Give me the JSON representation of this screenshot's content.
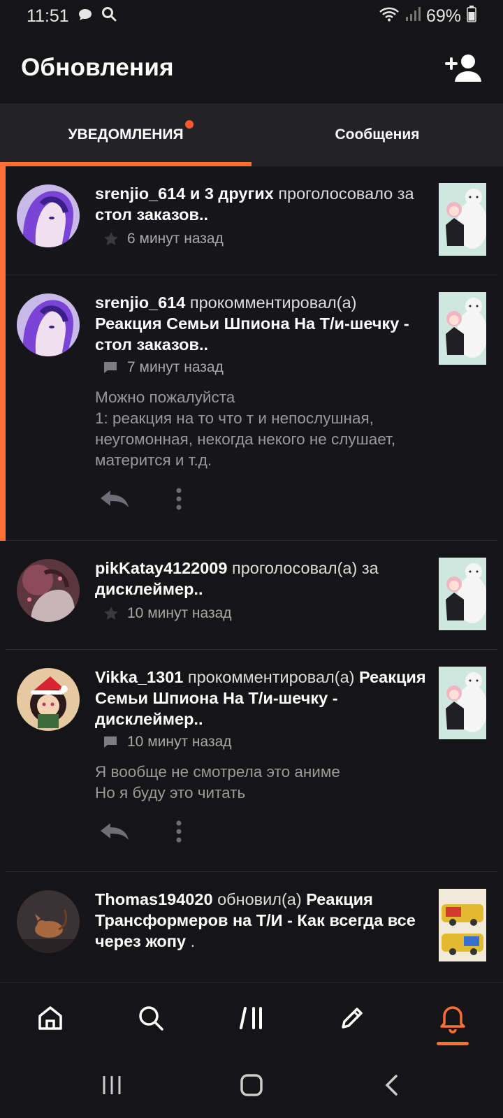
{
  "status_bar": {
    "time": "11:51",
    "battery": "69%"
  },
  "header": {
    "title": "Обновления"
  },
  "tabs": [
    {
      "label": "УВЕДОМЛЕНИЯ",
      "active": true,
      "has_dot": true
    },
    {
      "label": "Сообщения",
      "active": false,
      "has_dot": false
    }
  ],
  "notifications": [
    {
      "user": "srenjio_614 и 3 других",
      "action": "проголосовало за",
      "target": "стол заказов..",
      "meta_icon": "star-icon",
      "time": "6 минут назад",
      "unread": true
    },
    {
      "user": "srenjio_614",
      "action": "прокомментировал(а)",
      "target": "Реакция Семьи Шпиона На Т/и-шечку - стол заказов..",
      "meta_icon": "comment-icon",
      "time": "7 минут назад",
      "comment": "Можно пожалуйста\n1: реакция на то что т и непослушная, неугомонная, некогда некого не слушает, матерится и т.д.",
      "unread": true
    },
    {
      "user": "pikKatay4122009",
      "action": "проголосовал(а) за",
      "target": "дисклеймер..",
      "meta_icon": "star-icon",
      "time": "10 минут назад",
      "unread": false
    },
    {
      "user": "Vikka_1301",
      "action": "прокомментировал(а)",
      "target": "Реакция Семьи Шпиона На Т/и-шечку - дисклеймер..",
      "meta_icon": "comment-icon",
      "time": "10 минут назад",
      "comment": "Я вообще не смотрела это аниме\nНо я буду это читать",
      "unread": false
    },
    {
      "user": "Thomas194020",
      "action": "обновил(а)",
      "target": "Реакция Трансформеров на Т/И - Как всегда все через жопу",
      "target_suffix": ".",
      "unread": false
    }
  ],
  "bottom_nav": [
    {
      "icon": "home-icon",
      "active": false
    },
    {
      "icon": "search-icon",
      "active": false
    },
    {
      "icon": "library-icon",
      "active": false
    },
    {
      "icon": "write-icon",
      "active": false
    },
    {
      "icon": "bell-icon",
      "active": true
    }
  ],
  "colors": {
    "accent": "#ff6f37",
    "background": "#151417",
    "tab_bar": "#232226"
  }
}
